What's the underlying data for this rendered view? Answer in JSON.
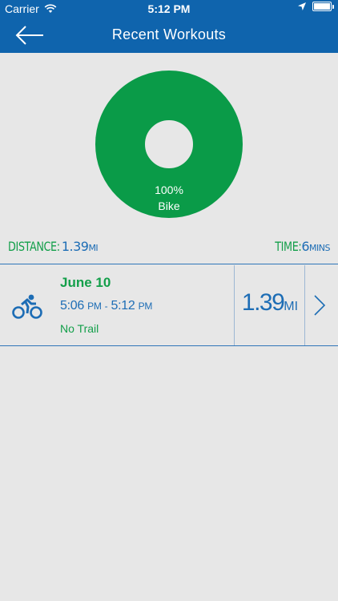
{
  "status_bar": {
    "carrier": "Carrier",
    "time": "5:12 PM",
    "icons": [
      "wifi-icon",
      "location-arrow-icon",
      "battery-icon"
    ]
  },
  "nav": {
    "back_icon": "back-arrow-icon",
    "title": "Recent Workouts"
  },
  "breakdown": {
    "percent": "100%",
    "activity": "Bike",
    "share": 1.0,
    "color": "#0a9b48"
  },
  "summary": {
    "distance_label": "DISTANCE:",
    "distance_value": "1.39",
    "distance_unit": "MI",
    "time_label": "TIME:",
    "time_value": "6",
    "time_unit": "MINS"
  },
  "workouts": [
    {
      "icon": "bike-icon",
      "date": "June 10",
      "start_time": "5:06",
      "start_ampm": "PM",
      "separator": "-",
      "end_time": "5:12",
      "end_ampm": "PM",
      "trail": "No Trail",
      "distance": "1.39",
      "distance_unit": "MI",
      "chevron": "chevron-right-icon"
    }
  ],
  "colors": {
    "brand_blue": "#0f64ad",
    "green": "#139f4a",
    "value_blue": "#1d6db5",
    "background": "#e7e7e7"
  }
}
